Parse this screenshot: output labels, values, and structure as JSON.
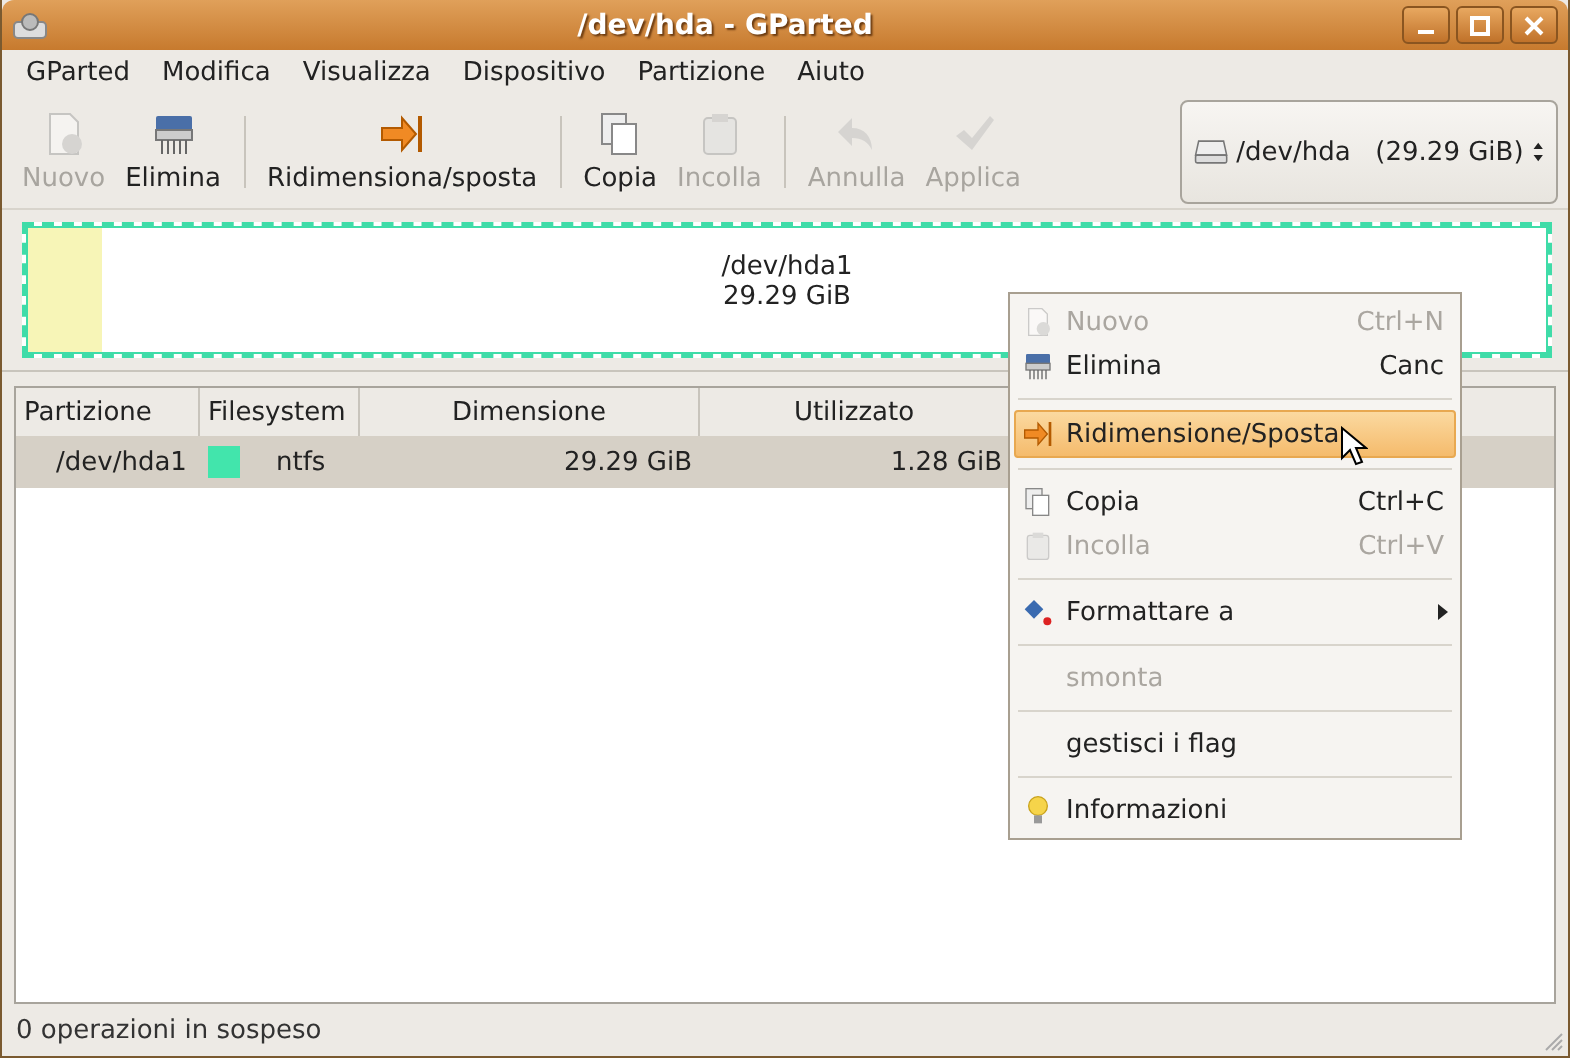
{
  "window": {
    "title": "/dev/hda - GParted"
  },
  "menubar": [
    "GParted",
    "Modifica",
    "Visualizza",
    "Dispositivo",
    "Partizione",
    "Aiuto"
  ],
  "toolbar": [
    {
      "kind": "button",
      "label": "Nuovo",
      "disabled": true
    },
    {
      "kind": "button",
      "label": "Elimina",
      "disabled": false
    },
    {
      "kind": "separator"
    },
    {
      "kind": "button",
      "label": "Ridimensiona/sposta",
      "disabled": false
    },
    {
      "kind": "separator"
    },
    {
      "kind": "button",
      "label": "Copia",
      "disabled": false
    },
    {
      "kind": "button",
      "label": "Incolla",
      "disabled": true
    },
    {
      "kind": "separator"
    },
    {
      "kind": "button",
      "label": "Annulla",
      "disabled": true
    },
    {
      "kind": "button",
      "label": "Applica",
      "disabled": true
    }
  ],
  "device_selector": {
    "device": "/dev/hda",
    "size": "(29.29 GiB)"
  },
  "partition_map": {
    "name": "/dev/hda1",
    "size": "29.29 GiB",
    "level": 0.05,
    "selected": true
  },
  "table": {
    "columns": [
      "Partizione",
      "Filesystem",
      "Dimensione",
      "Utilizzato"
    ],
    "rows": [
      {
        "partition": "/dev/hda1",
        "color": "#42e5ac",
        "filesystem": "ntfs",
        "size": "29.29 GiB",
        "used": "1.28 GiB",
        "selected": true
      }
    ]
  },
  "context_menu": [
    {
      "kind": "item",
      "label": "Nuovo",
      "shortcut": "Ctrl+N",
      "disabled": true,
      "selected": false
    },
    {
      "kind": "item",
      "label": "Elimina",
      "shortcut": "Canc",
      "disabled": false,
      "selected": false
    },
    {
      "kind": "separator"
    },
    {
      "kind": "item",
      "label": "Ridimensione/Sposta",
      "disabled": false,
      "selected": true
    },
    {
      "kind": "separator"
    },
    {
      "kind": "item",
      "label": "Copia",
      "shortcut": "Ctrl+C",
      "disabled": false,
      "selected": false
    },
    {
      "kind": "item",
      "label": "Incolla",
      "shortcut": "Ctrl+V",
      "disabled": true,
      "selected": false
    },
    {
      "kind": "separator"
    },
    {
      "kind": "item",
      "label": "Formattare a",
      "submenu": true,
      "disabled": false,
      "selected": false
    },
    {
      "kind": "separator"
    },
    {
      "kind": "item",
      "label": "smonta",
      "disabled": true,
      "selected": false
    },
    {
      "kind": "separator"
    },
    {
      "kind": "item",
      "label": "gestisci i flag",
      "disabled": false,
      "selected": false
    },
    {
      "kind": "separator"
    },
    {
      "kind": "item",
      "label": "Informazioni",
      "disabled": false,
      "selected": false
    }
  ],
  "status_bar": "0 operazioni in sospeso"
}
